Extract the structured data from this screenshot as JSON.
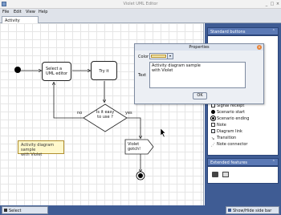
{
  "window": {
    "title": "Violet UML Editor"
  },
  "menu": {
    "file": "File",
    "edit": "Edit",
    "view": "View",
    "help": "Help"
  },
  "tabs": [
    {
      "label": "Activity diagram*"
    }
  ],
  "diagram": {
    "node1": {
      "line1": "Select a",
      "line2": "UML editor"
    },
    "node2": {
      "label": "Try it"
    },
    "decision": {
      "line1": "Is it easy",
      "line2": "to use ?"
    },
    "no_label": "no",
    "yes_label": "yes",
    "signal": {
      "line1": "Violet",
      "line2": "gotch!"
    },
    "note": {
      "line1": "Activity diagram sample",
      "line2": "with Violet"
    }
  },
  "standard_buttons": {
    "header": "Standard buttons",
    "items": [
      "Signal receipt",
      "Scenario start",
      "Scenario ending",
      "Note",
      "Diagram link",
      "Transition",
      "Note connector"
    ]
  },
  "extended_features": {
    "header": "Extended features"
  },
  "properties_dialog": {
    "title": "Properties",
    "color_label": "Color",
    "color_value": "#f5e6a8",
    "text_label": "Text",
    "text_value_line1": "Activity diagram sample",
    "text_value_line2": "with Violet",
    "ok_label": "OK"
  },
  "statusbar": {
    "select_label": "Select",
    "toggle_label": "Show/Hide side bar"
  },
  "colors": {
    "sidebar": "#3f5c94",
    "panel_header": "#5b79b5",
    "note_fill": "#fff8cc",
    "close_button": "#e8843a"
  }
}
